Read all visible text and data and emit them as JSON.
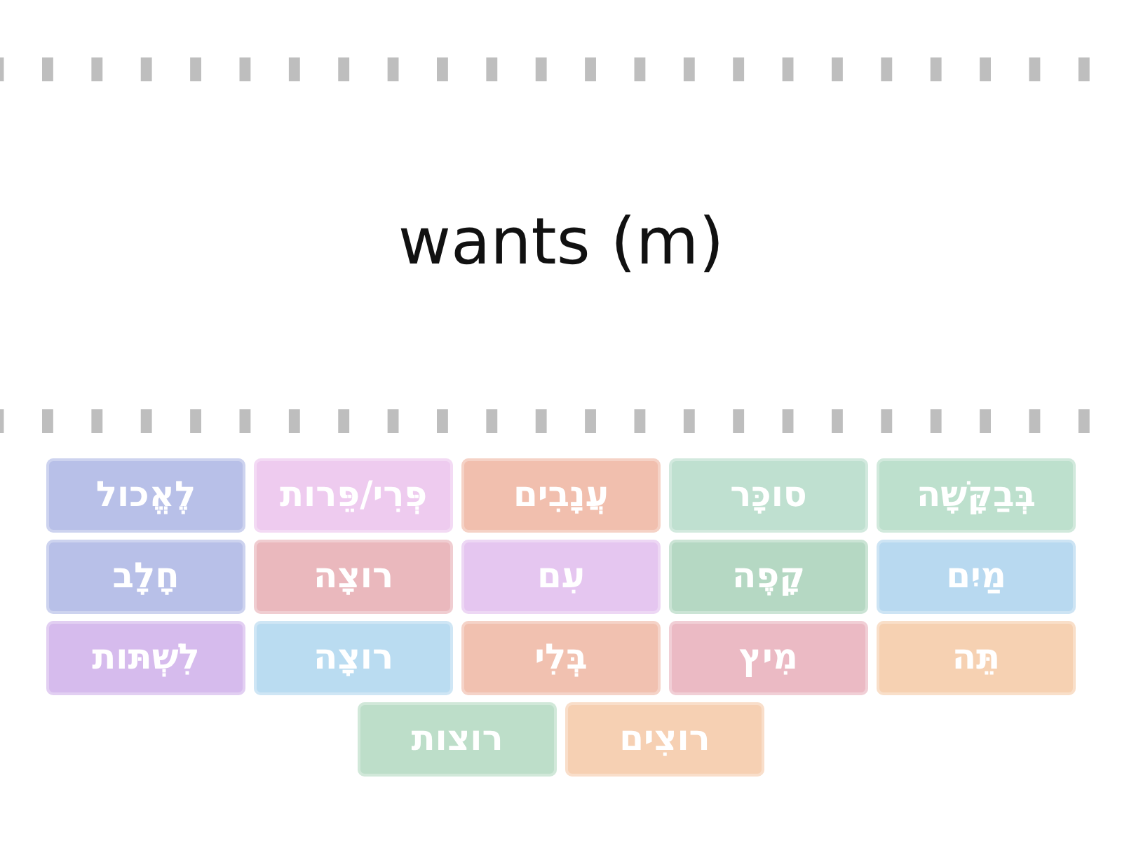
{
  "prompt": {
    "text": "wants (m)"
  },
  "tiles": [
    {
      "label": "בְּבַקָּשָׁה",
      "color": "#bde0cd"
    },
    {
      "label": "סוכָּר",
      "color": "#bfe0d0"
    },
    {
      "label": "עֲנָבִים",
      "color": "#f1bfae"
    },
    {
      "label": "פְּרִי/פֵּרות",
      "color": "#eecbef"
    },
    {
      "label": "לֶאֱכול",
      "color": "#b8c0e8"
    },
    {
      "label": "מַיִם",
      "color": "#b8d9f0"
    },
    {
      "label": "קָפֶה",
      "color": "#b5d8c3"
    },
    {
      "label": "עִם",
      "color": "#e5c6f0"
    },
    {
      "label": "רוצָה",
      "color": "#eab8bd"
    },
    {
      "label": "חָלָב",
      "color": "#b8c0e8"
    },
    {
      "label": "תֵּה",
      "color": "#f6d1b2"
    },
    {
      "label": "מִיץ",
      "color": "#ebbac4"
    },
    {
      "label": "בְּלִי",
      "color": "#f1c1b0"
    },
    {
      "label": "רוצָה",
      "color": "#badcf1"
    },
    {
      "label": "לִשְׁתּות",
      "color": "#d6bbed"
    },
    {
      "label": "רוצִים",
      "color": "#f6d0b3"
    },
    {
      "label": "רוצות",
      "color": "#bddec9"
    }
  ]
}
